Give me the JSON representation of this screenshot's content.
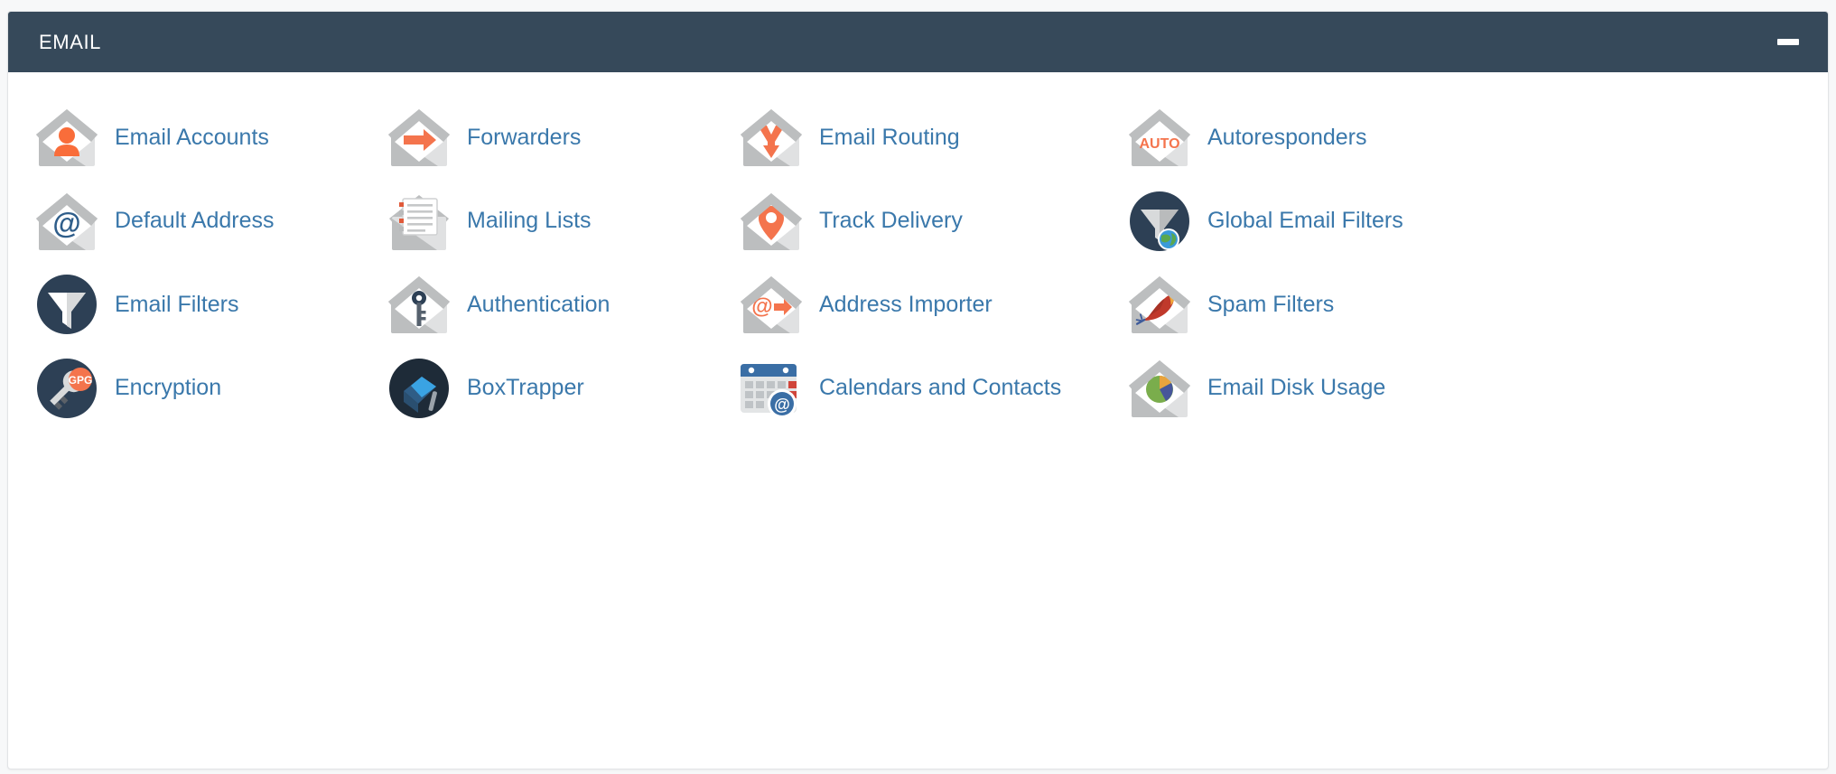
{
  "panel": {
    "title": "EMAIL",
    "collapse_label": "Collapse",
    "collapse_icon": "minus-icon",
    "header_color": "#36495a",
    "link_color": "#3a78ab",
    "accent_orange": "#f4744d",
    "accent_navy": "#2d4055",
    "background": "#ffffff"
  },
  "items": [
    {
      "label": "Email Accounts",
      "icon": "envelope-person-icon",
      "name": "email-accounts"
    },
    {
      "label": "Forwarders",
      "icon": "envelope-arrow-icon",
      "name": "forwarders"
    },
    {
      "label": "Email Routing",
      "icon": "envelope-routing-icon",
      "name": "email-routing"
    },
    {
      "label": "Autoresponders",
      "icon": "envelope-auto-icon",
      "name": "autoresponders"
    },
    {
      "label": "Default Address",
      "icon": "envelope-at-icon",
      "name": "default-address"
    },
    {
      "label": "Mailing Lists",
      "icon": "envelope-list-icon",
      "name": "mailing-lists"
    },
    {
      "label": "Track Delivery",
      "icon": "envelope-pin-icon",
      "name": "track-delivery"
    },
    {
      "label": "Global Email Filters",
      "icon": "funnel-globe-icon",
      "name": "global-email-filters"
    },
    {
      "label": "Email Filters",
      "icon": "funnel-icon",
      "name": "email-filters"
    },
    {
      "label": "Authentication",
      "icon": "envelope-key-icon",
      "name": "authentication"
    },
    {
      "label": "Address Importer",
      "icon": "envelope-at-arrow-icon",
      "name": "address-importer"
    },
    {
      "label": "Spam Filters",
      "icon": "envelope-feather-icon",
      "name": "spam-filters"
    },
    {
      "label": "Encryption",
      "icon": "key-gpg-icon",
      "name": "encryption"
    },
    {
      "label": "BoxTrapper",
      "icon": "box-trap-icon",
      "name": "boxtrapper"
    },
    {
      "label": "Calendars and Contacts",
      "icon": "calendar-at-icon",
      "name": "calendars-and-contacts"
    },
    {
      "label": "Email Disk Usage",
      "icon": "envelope-pie-icon",
      "name": "email-disk-usage"
    }
  ]
}
